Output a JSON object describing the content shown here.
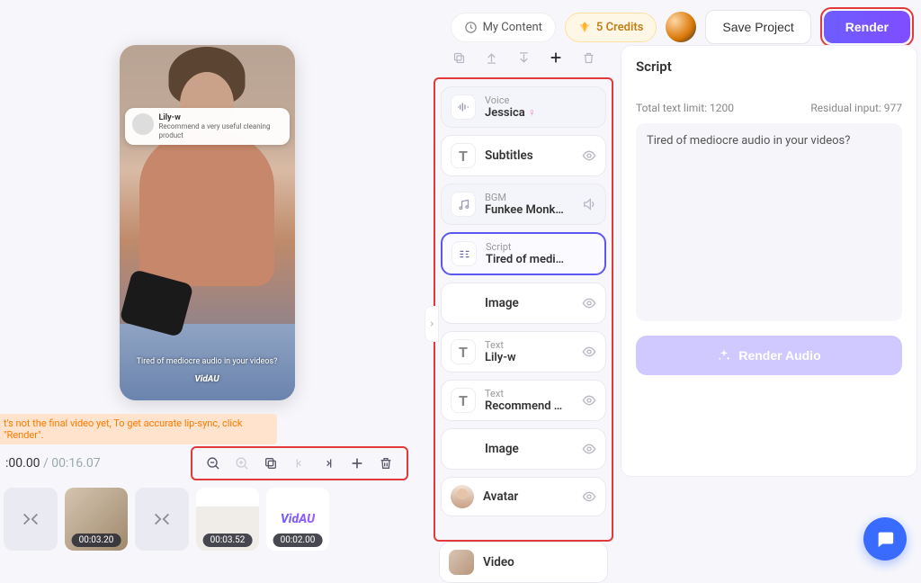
{
  "topbar": {
    "my_content": "My Content",
    "credits": "5 Credits",
    "save": "Save Project",
    "render": "Render"
  },
  "preview": {
    "overlay_name": "Lily-w",
    "overlay_desc": "Recommend a very useful cleaning product",
    "caption": "Tired of mediocre audio in your videos?",
    "watermark": "VidAU",
    "tip": "t's not the final video yet, To get accurate lip-sync, click \"Render\"."
  },
  "timeline": {
    "current": ":00.00",
    "separator": " / ",
    "duration": "00:16.07"
  },
  "clips": [
    {
      "duration": "00:03.20"
    },
    {
      "duration": "00:03.52"
    },
    {
      "duration": "00:02.00"
    }
  ],
  "layers": {
    "voice_label": "Voice",
    "voice_value": "Jessica",
    "subtitles": "Subtitles",
    "bgm_label": "BGM",
    "bgm_value": "Funkee Monk…",
    "script_label": "Script",
    "script_value": "Tired of medi…",
    "image": "Image",
    "text_label": "Text",
    "text1_value": "Lily-w",
    "text2_value": "Recommend …",
    "image2": "Image",
    "avatar": "Avatar",
    "video": "Video"
  },
  "script_panel": {
    "title": "Script",
    "limit_label": "Total text limit: 1200",
    "residual_label": "Residual input: 977",
    "text": "Tired of mediocre audio in your videos?",
    "render_audio": "Render Audio"
  },
  "brand": "VidAU"
}
